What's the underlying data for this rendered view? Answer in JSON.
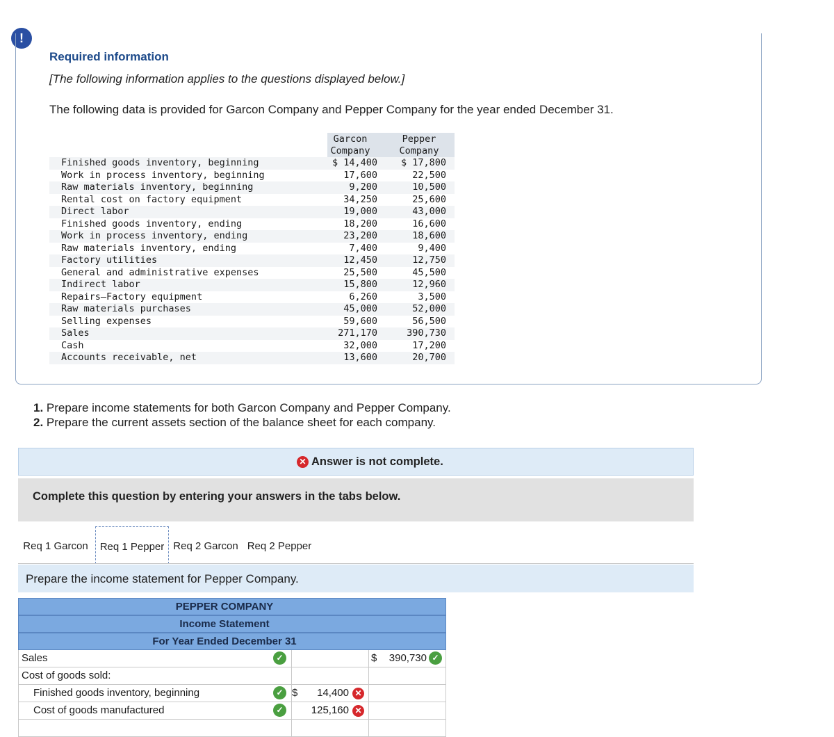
{
  "header": {
    "info_icon": "!",
    "required_title": "Required information",
    "subtitle": "[The following information applies to the questions displayed below.]",
    "intro": "The following data is provided for Garcon Company and Pepper Company for the year ended December 31."
  },
  "data_table": {
    "col_garcon_line1": "Garcon",
    "col_garcon_line2": "Company",
    "col_pepper_line1": "Pepper",
    "col_pepper_line2": "Company",
    "rows": [
      {
        "label": "Finished goods inventory, beginning",
        "garcon": "$ 14,400",
        "pepper": "$ 17,800"
      },
      {
        "label": "Work in process inventory, beginning",
        "garcon": "17,600",
        "pepper": "22,500"
      },
      {
        "label": "Raw materials inventory, beginning",
        "garcon": "9,200",
        "pepper": "10,500"
      },
      {
        "label": "Rental cost on factory equipment",
        "garcon": "34,250",
        "pepper": "25,600"
      },
      {
        "label": "Direct labor",
        "garcon": "19,000",
        "pepper": "43,000"
      },
      {
        "label": "Finished goods inventory, ending",
        "garcon": "18,200",
        "pepper": "16,600"
      },
      {
        "label": "Work in process inventory, ending",
        "garcon": "23,200",
        "pepper": "18,600"
      },
      {
        "label": "Raw materials inventory, ending",
        "garcon": "7,400",
        "pepper": "9,400"
      },
      {
        "label": "Factory utilities",
        "garcon": "12,450",
        "pepper": "12,750"
      },
      {
        "label": "General and administrative expenses",
        "garcon": "25,500",
        "pepper": "45,500"
      },
      {
        "label": "Indirect labor",
        "garcon": "15,800",
        "pepper": "12,960"
      },
      {
        "label": "Repairs—Factory equipment",
        "garcon": "6,260",
        "pepper": "3,500"
      },
      {
        "label": "Raw materials purchases",
        "garcon": "45,000",
        "pepper": "52,000"
      },
      {
        "label": "Selling expenses",
        "garcon": "59,600",
        "pepper": "56,500"
      },
      {
        "label": "Sales",
        "garcon": "271,170",
        "pepper": "390,730"
      },
      {
        "label": "Cash",
        "garcon": "32,000",
        "pepper": "17,200"
      },
      {
        "label": "Accounts receivable, net",
        "garcon": "13,600",
        "pepper": "20,700"
      }
    ]
  },
  "instructions": {
    "item1_num": "1.",
    "item1_text": "Prepare income statements for both Garcon Company and Pepper Company.",
    "item2_num": "2.",
    "item2_text": "Prepare the current assets section of the balance sheet for each company."
  },
  "status": {
    "icon": "✕",
    "text": "Answer is not complete."
  },
  "complete_prompt": "Complete this question by entering your answers in the tabs below.",
  "tabs": [
    {
      "label": "Req 1 Garcon"
    },
    {
      "label": "Req 1 Pepper"
    },
    {
      "label": "Req 2 Garcon"
    },
    {
      "label": "Req 2 Pepper"
    }
  ],
  "active_tab": "Req 1 Pepper",
  "prompt": "Prepare the income statement for Pepper Company.",
  "statement": {
    "company": "PEPPER COMPANY",
    "title": "Income Statement",
    "period": "For Year Ended December 31",
    "rows": {
      "sales_label": "Sales",
      "sales_dollar": "$",
      "sales_value": "390,730",
      "cogs_label": "Cost of goods sold:",
      "fg_label": "Finished goods inventory, beginning",
      "fg_dollar": "$",
      "fg_value": "14,400",
      "cogm_label": "Cost of goods manufactured",
      "cogm_value": "125,160"
    }
  },
  "colors": {
    "accent_blue": "#1d4a8a",
    "correct_green": "#4a9f40",
    "wrong_red": "#d6282c",
    "header_blue": "#7ba9e0"
  }
}
